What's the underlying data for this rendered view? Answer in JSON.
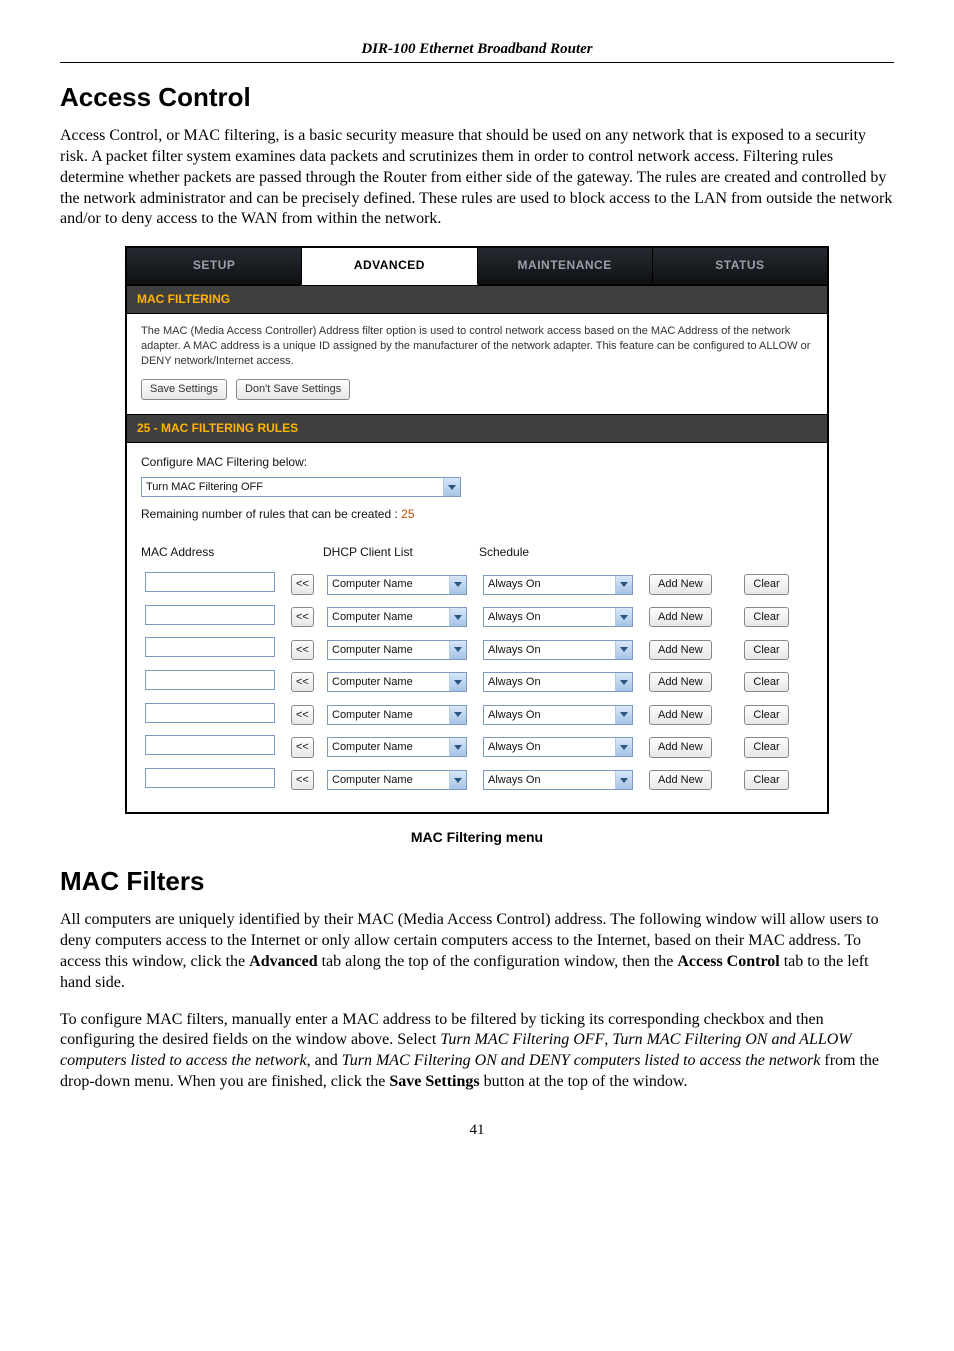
{
  "header": {
    "title": "DIR-100 Ethernet Broadband Router"
  },
  "section1": {
    "heading": "Access Control",
    "para": "Access Control, or MAC filtering, is a basic security measure that should be used on any network that is exposed to a security risk. A packet filter system examines data packets and scrutinizes them in order to control network access. Filtering rules determine whether packets are passed through the Router from either side of the gateway. The rules are created and controlled by the network administrator and can be precisely defined. These rules are used to block access to the LAN from outside the network and/or to deny access to the WAN from within the network."
  },
  "ui": {
    "tabs": {
      "setup": "SETUP",
      "advanced": "ADVANCED",
      "maintenance": "MAINTENANCE",
      "status": "STATUS"
    },
    "band1": "MAC FILTERING",
    "intro": "The MAC (Media Access Controller) Address filter option is used to control network access based on the MAC Address of the network adapter. A MAC address is a unique ID assigned by the manufacturer of the network adapter. This feature can be configured to ALLOW or DENY network/Internet access.",
    "save_label": "Save Settings",
    "dontsave_label": "Don't Save Settings",
    "band2": "25 - MAC FILTERING RULES",
    "configure_label": "Configure MAC Filtering below:",
    "filter_select_value": "Turn MAC Filtering OFF",
    "remaining_prefix": "Remaining number of rules that can be created : ",
    "remaining_count": "25",
    "cols": {
      "mac": "MAC Address",
      "dhcp": "DHCP Client List",
      "schedule": "Schedule"
    },
    "row_common": {
      "mac_value": "",
      "ll_label": "<<",
      "dhcp_value": "Computer Name",
      "schedule_value": "Always On",
      "addnew_label": "Add New",
      "clear_label": "Clear"
    },
    "row_count": 7
  },
  "figure_caption": "MAC Filtering menu",
  "section2": {
    "heading": "MAC Filters",
    "para1_pre": "All computers are uniquely identified by their MAC (Media Access Control) address. The following window will allow users to deny computers access to the Internet or only allow certain computers access to the Internet, based on their MAC address. To access this window, click the ",
    "para1_bold1": "Advanced",
    "para1_mid": " tab along the top of the configuration window, then the ",
    "para1_bold2": "Access Control",
    "para1_post": " tab to the left hand side.",
    "para2_pre": "To configure MAC filters, manually enter a MAC address to be filtered by ticking its corresponding checkbox and then configuring the desired fields on the window above. Select ",
    "para2_it1": "Turn MAC Filtering OFF",
    "para2_mid1": ", ",
    "para2_it2": "Turn MAC Filtering ON and ALLOW computers listed to access the network",
    "para2_mid2": ", and ",
    "para2_it3": "Turn MAC Filtering ON and DENY computers listed to access the network",
    "para2_mid3": " from the drop-down menu. When you are finished, click the ",
    "para2_bold": "Save Settings",
    "para2_post": " button at the top of the window."
  },
  "page_number": "41"
}
